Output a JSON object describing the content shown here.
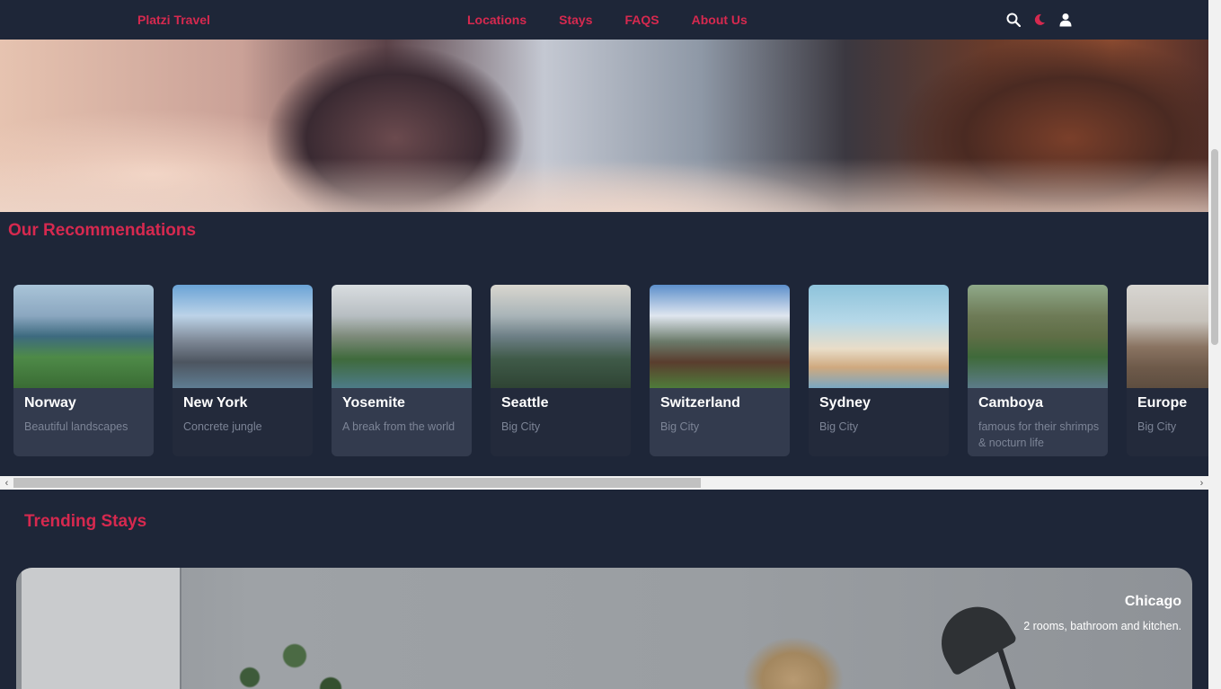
{
  "header": {
    "brand": "Platzi Travel",
    "nav": [
      "Locations",
      "Stays",
      "FAQS",
      "About Us"
    ],
    "icons": [
      "search-icon",
      "moon-icon",
      "user-icon"
    ],
    "accent_color": "#d6294f"
  },
  "recommendations": {
    "title": "Our Recommendations",
    "cards": [
      {
        "title": "Norway",
        "description": "Beautiful landscapes"
      },
      {
        "title": "New York",
        "description": "Concrete jungle"
      },
      {
        "title": "Yosemite",
        "description": "A break from the world"
      },
      {
        "title": "Seattle",
        "description": "Big City"
      },
      {
        "title": "Switzerland",
        "description": "Big City"
      },
      {
        "title": "Sydney",
        "description": "Big City"
      },
      {
        "title": "Camboya",
        "description": "famous for their shrimps & nocturn life"
      },
      {
        "title": "Europe",
        "description": "Big City"
      }
    ]
  },
  "trending": {
    "title": "Trending Stays",
    "stays": [
      {
        "title": "Chicago",
        "description": "2 rooms, bathroom and kitchen."
      }
    ]
  }
}
